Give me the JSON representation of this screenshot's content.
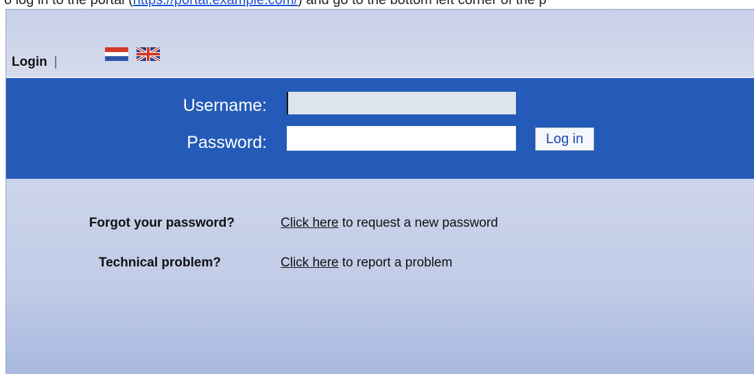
{
  "top_fragment": {
    "prefix": "o log in to the portal (",
    "link": "https://portal.example.com/",
    "suffix": ") and go to the bottom left corner of the p"
  },
  "header": {
    "title": "Login",
    "separator": "|",
    "flags": [
      "Dutch",
      "English"
    ]
  },
  "form": {
    "username_label": "Username:",
    "password_label": "Password:",
    "username_value": "",
    "password_value": "",
    "submit_label": "Log in"
  },
  "help": [
    {
      "question": "Forgot your password?",
      "link": "Click here",
      "text": " to request a new password"
    },
    {
      "question": "Technical problem?",
      "link": "Click here",
      "text": " to report a problem"
    }
  ],
  "colors": {
    "bar": "#255bb8",
    "panel": "#cdd5ea",
    "button_text": "#1a46b8"
  },
  "icons": [
    "netherlands-flag-icon",
    "uk-flag-icon"
  ]
}
